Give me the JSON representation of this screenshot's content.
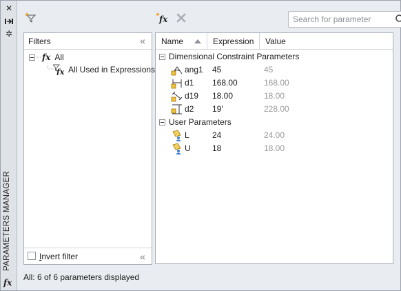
{
  "palette": {
    "title": "PARAMETERS MANAGER"
  },
  "toolbar": {
    "search_placeholder": "Search for parameter"
  },
  "filters": {
    "title": "Filters",
    "tree": [
      {
        "label": "All",
        "icon": "fx-icon",
        "expanded": true
      },
      {
        "label": "All Used in Expressions",
        "icon": "filter-fx-icon"
      }
    ],
    "invert_label": "Invert filter",
    "invert_checked": false
  },
  "grid": {
    "columns": [
      "Name",
      "Expression",
      "Value"
    ],
    "sort_column": "Name",
    "groups": [
      {
        "label": "Dimensional Constraint Parameters",
        "expanded": true,
        "rows": [
          {
            "icon": "angular-constraint-icon",
            "name": "ang1",
            "expression": "45",
            "value": "45"
          },
          {
            "icon": "horizontal-constraint-icon",
            "name": "d1",
            "expression": "168.00",
            "value": "168.00"
          },
          {
            "icon": "aligned-constraint-icon",
            "name": "d19",
            "expression": "18.00",
            "value": "18.00"
          },
          {
            "icon": "vertical-constraint-icon",
            "name": "d2",
            "expression": "19'",
            "value": "228.00"
          }
        ]
      },
      {
        "label": "User Parameters",
        "expanded": true,
        "rows": [
          {
            "icon": "user-parameter-icon",
            "name": "L",
            "expression": "24",
            "value": "24.00"
          },
          {
            "icon": "user-parameter-icon",
            "name": "U",
            "expression": "18",
            "value": "18.00"
          }
        ]
      }
    ]
  },
  "status": "All: 6 of 6 parameters displayed"
}
